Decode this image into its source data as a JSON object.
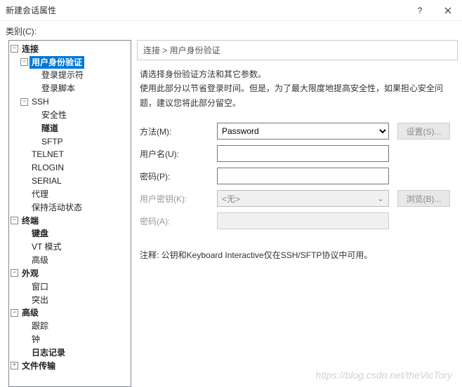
{
  "window": {
    "title": "新建会话属性",
    "category_label": "类别(C):"
  },
  "tree": {
    "connection": "连接",
    "auth": "用户身份验证",
    "login_prompt": "登录提示符",
    "login_script": "登录脚本",
    "ssh": "SSH",
    "security": "安全性",
    "tunnel": "隧道",
    "sftp": "SFTP",
    "telnet": "TELNET",
    "rlogin": "RLOGIN",
    "serial": "SERIAL",
    "proxy": "代理",
    "keepalive": "保持活动状态",
    "terminal": "终端",
    "keyboard": "键盘",
    "vt": "VT 模式",
    "advanced_t": "高级",
    "appearance": "外观",
    "window": "窗口",
    "highlight": "突出",
    "advanced": "高级",
    "trace": "跟踪",
    "bell": "钟",
    "logging": "日志记录",
    "filetransfer": "文件传输"
  },
  "panel": {
    "breadcrumb": "连接  >  用户身份验证",
    "desc_line1": "请选择身份验证方法和其它参数。",
    "desc_line2": "使用此部分以节省登录时间。但是，为了最大限度地提高安全性，如果担心安全问题，建议您将此部分留空。",
    "method_label": "方法(M):",
    "method_value": "Password",
    "settings_btn": "设置(S)...",
    "username_label": "用户名(U):",
    "username_value": "",
    "password_label": "密码(P):",
    "password_value": "",
    "userkey_label": "用户密钥(K):",
    "userkey_value": "<无>",
    "browse_btn": "浏览(B)...",
    "passphrase_label": "密码(A):",
    "note": "注释: 公钥和Keyboard Interactive仅在SSH/SFTP协议中可用。"
  },
  "watermark": "https://blog.csdn.net/theVicTory"
}
